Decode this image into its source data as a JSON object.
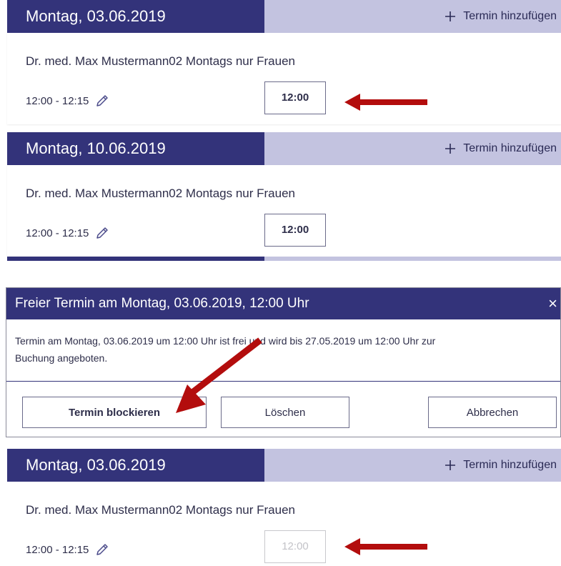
{
  "colors": {
    "header_dark": "#33337a",
    "header_light": "#c3c3e0",
    "arrow_red": "#b30d0d",
    "text": "#2e2e4a",
    "blocked_text": "#c3c3c8"
  },
  "icons": {
    "add": "plus-icon",
    "edit": "pencil-icon",
    "close": "close-icon"
  },
  "panels": [
    {
      "date_title": "Montag, 03.06.2019",
      "add_label": "Termin hinzufügen",
      "doctor": "Dr. med. Max Mustermann02 Montags nur Frauen",
      "time_range": "12:00 - 12:15",
      "slot": "12:00",
      "slot_state": "free"
    },
    {
      "date_title": "Montag, 10.06.2019",
      "add_label": "Termin hinzufügen",
      "doctor": "Dr. med. Max Mustermann02 Montags nur Frauen",
      "time_range": "12:00 - 12:15",
      "slot": "12:00",
      "slot_state": "free"
    },
    {
      "date_title": "Montag, 03.06.2019",
      "add_label": "Termin hinzufügen",
      "doctor": "Dr. med. Max Mustermann02 Montags nur Frauen",
      "time_range": "12:00 - 12:15",
      "slot": "12:00",
      "slot_state": "blocked"
    }
  ],
  "dialog": {
    "title": "Freier Termin am Montag, 03.06.2019, 12:00 Uhr",
    "close_glyph": "×",
    "body_line1": "Termin am Montag, 03.06.2019 um 12:00 Uhr ist frei und wird bis 27.05.2019 um 12:00 Uhr zur",
    "body_line2": "Buchung angeboten.",
    "buttons": {
      "block": "Termin blockieren",
      "delete": "Löschen",
      "cancel": "Abbrechen"
    }
  }
}
